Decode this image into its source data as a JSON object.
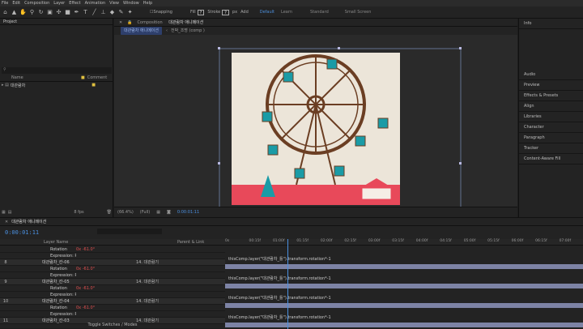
{
  "menu": [
    "File",
    "Edit",
    "Composition",
    "Layer",
    "Effect",
    "Animation",
    "View",
    "Window",
    "Help"
  ],
  "toolbar": {
    "snapping": "Snapping",
    "fill": "Fill",
    "stroke": "Stroke",
    "px": "px",
    "add": "Add",
    "workspaces": [
      "Default",
      "Learn",
      "Standard",
      "Small Screen"
    ]
  },
  "project": {
    "title": "Project",
    "col_name": "Name",
    "col_comment": "Comment",
    "folder": "대관람차"
  },
  "comp": {
    "tab": "Composition",
    "tab_name": "대관람차 애니메이션",
    "crumb1": "대관람차 애니메이션",
    "crumb2": "전박_조명 (comp )",
    "zoom": "(66.4%)",
    "res": "(Full)",
    "timecode": "0:00:01:11",
    "fps": "8 fps"
  },
  "right": {
    "info": "Info",
    "items": [
      "Audio",
      "Preview",
      "Effects & Presets",
      "Align",
      "Libraries",
      "Character",
      "Paragraph",
      "Tracker",
      "Content-Aware Fill"
    ]
  },
  "timeline": {
    "tab": "대관람차 애니메이션",
    "timecode": "0:00:01:11",
    "col_name": "Layer Name",
    "col_parent": "Parent & Link",
    "footer": "Toggle Switches / Modes",
    "ruler": [
      "0s",
      "00:15f",
      "01:00f",
      "01:15f",
      "02:00f",
      "02:15f",
      "03:00f",
      "03:15f",
      "04:00f",
      "04:15f",
      "05:00f",
      "05:15f",
      "06:00f",
      "06:15f",
      "07:00f"
    ],
    "rows": [
      {
        "type": "prop",
        "name": "Rotation",
        "val": "0x -61.0°"
      },
      {
        "type": "prop",
        "name": "Expression: Rotation",
        "val": ""
      },
      {
        "type": "layer",
        "idx": "8",
        "name": "대관람차_칸-06",
        "parent": "14. 대관람기"
      },
      {
        "type": "prop",
        "name": "Rotation",
        "val": "0x -61.0°"
      },
      {
        "type": "prop",
        "name": "Expression: Rotation",
        "val": ""
      },
      {
        "type": "layer",
        "idx": "9",
        "name": "대관람차_칸-05",
        "parent": "14. 대관람기"
      },
      {
        "type": "prop",
        "name": "Rotation",
        "val": "0x -61.0°"
      },
      {
        "type": "prop",
        "name": "Expression: Rotation",
        "val": ""
      },
      {
        "type": "layer",
        "idx": "10",
        "name": "대관람차_칸-04",
        "parent": "14. 대관람기"
      },
      {
        "type": "prop",
        "name": "Rotation",
        "val": "0x -61.0°"
      },
      {
        "type": "prop",
        "name": "Expression: Rotation",
        "val": ""
      },
      {
        "type": "layer",
        "idx": "11",
        "name": "대관람차_칸-03",
        "parent": "14. 대관람기"
      }
    ],
    "expression": "thisComp.layer(\"대관람차_틀\").transform.rotation*-1"
  }
}
